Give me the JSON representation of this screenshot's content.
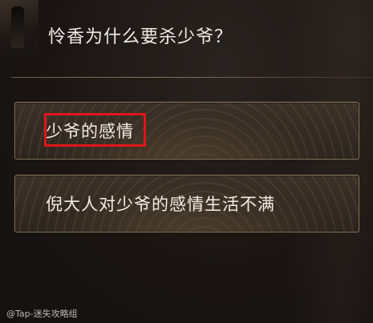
{
  "question": "怜香为什么要杀少爷？",
  "options": [
    {
      "label": "少爷的感情"
    },
    {
      "label": "倪大人对少爷的感情生活不满"
    }
  ],
  "watermark": "@Tap-迷失攻略组",
  "colors": {
    "highlight": "#e0161a",
    "option_border": "#8c7a5c",
    "text": "#f1ece4"
  }
}
